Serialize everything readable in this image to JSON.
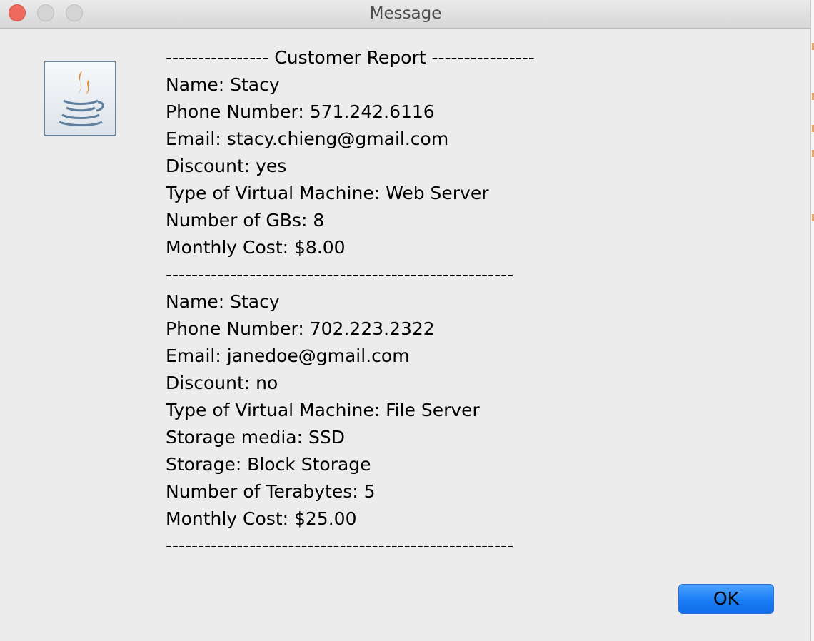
{
  "window": {
    "title": "Message"
  },
  "report": {
    "header": "---------------- Customer Report ----------------",
    "customers": [
      {
        "lines": [
          "Name: Stacy",
          "Phone Number: 571.242.6116",
          "Email: stacy.chieng@gmail.com",
          "Discount: yes",
          "Type of Virtual Machine: Web Server",
          "Number of GBs: 8",
          "Monthly Cost: $8.00"
        ],
        "separator": "------------------------------------------------------"
      },
      {
        "lines": [
          "Name: Stacy",
          "Phone Number: 702.223.2322",
          "Email: janedoe@gmail.com",
          "Discount: no",
          "Type of Virtual Machine: File Server",
          "Storage media: SSD",
          "Storage: Block Storage",
          "Number of Terabytes: 5",
          "Monthly Cost: $25.00"
        ],
        "separator": "------------------------------------------------------"
      }
    ]
  },
  "buttons": {
    "ok_label": "OK"
  },
  "icons": {
    "dialog_icon": "java-icon",
    "close": "close-icon",
    "minimize": "minimize-icon",
    "zoom": "zoom-icon"
  },
  "colors": {
    "accent": "#1a7cf5",
    "close_button": "#ee6a5f",
    "background": "#ececec"
  }
}
